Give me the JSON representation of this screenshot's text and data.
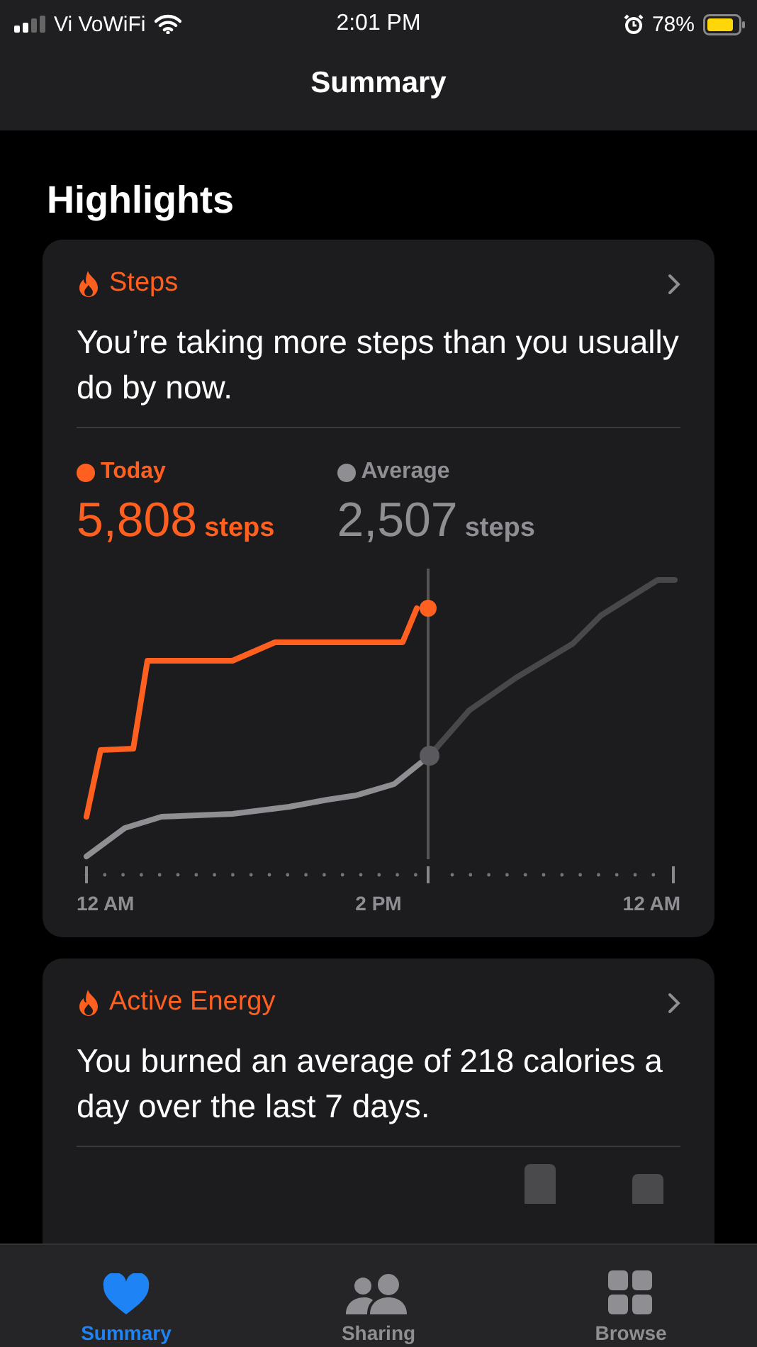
{
  "status_bar": {
    "carrier": "Vi VoWiFi",
    "time": "2:01 PM",
    "battery": "78%"
  },
  "nav": {
    "title": "Summary"
  },
  "section_title": "Highlights",
  "cards": [
    {
      "title": "Steps",
      "message": "You’re taking more steps than you usually do by now.",
      "legend": [
        {
          "label": "Today",
          "value": "5,808",
          "unit": "steps",
          "color": "#ff5f1f"
        },
        {
          "label": "Average",
          "value": "2,507",
          "unit": "steps",
          "color": "#8e8e93"
        }
      ],
      "x_labels": [
        "12 AM",
        "2 PM",
        "12 AM"
      ]
    },
    {
      "title": "Active Energy",
      "message": "You burned an average of 218 calories a day over the last 7 days."
    }
  ],
  "tabs": [
    {
      "label": "Summary",
      "selected": true
    },
    {
      "label": "Sharing",
      "selected": false
    },
    {
      "label": "Browse",
      "selected": false
    }
  ]
}
